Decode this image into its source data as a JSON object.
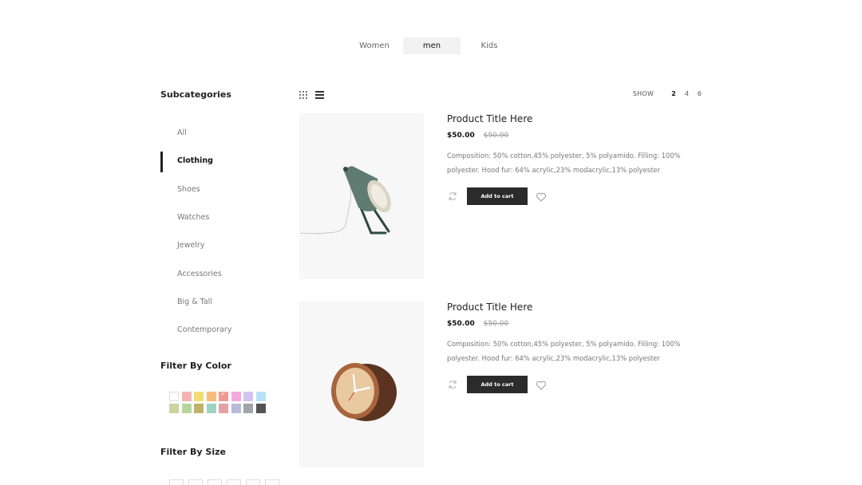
{
  "tabs": [
    {
      "label": "Women",
      "active": false
    },
    {
      "label": "men",
      "active": true
    },
    {
      "label": "Kids",
      "active": false
    }
  ],
  "sidebar": {
    "subcategories_title": "Subcategories",
    "subcategories": [
      "All",
      "Clothing",
      "Shoes",
      "Watches",
      "Jewelry",
      "Accessories",
      "Big & Tall",
      "Contemporary"
    ],
    "active_subcategory": "Clothing",
    "color_title": "Filter By Color",
    "colors": [
      "#ffffff",
      "#f4b3b3",
      "#f4dc74",
      "#f6bd7a",
      "#f2998f",
      "#f5a8de",
      "#d4c2f3",
      "#b8e0f5",
      "#cad2a2",
      "#b6d59e",
      "#c0b267",
      "#9fd4c4",
      "#e0a2a7",
      "#b6bbd9",
      "#a3a3ac",
      "#545454"
    ],
    "selected_color_index": 4,
    "size_title": "Filter By Size"
  },
  "toolbar": {
    "show_label": "SHOW",
    "show_options": [
      "2",
      "4",
      "6"
    ],
    "show_selected": "2"
  },
  "products": [
    {
      "title": "Product Title Here",
      "price": "$50.00",
      "old_price": "$50.00",
      "description": "Composition: 50% cotton,45% polyester, 5% polyamido. Filling: 100% polyester. Hood fur: 64% acrylic,23% modacrylic,13% polyester",
      "cart_label": "Add to cart",
      "image": "desk-lamp"
    },
    {
      "title": "Product Title Here",
      "price": "$50.00",
      "old_price": "$50.00",
      "description": "Composition: 50% cotton,45% polyester, 5% polyamido. Filling: 100% polyester. Hood fur: 64% acrylic,23% modacrylic,13% polyester",
      "cart_label": "Add to cart",
      "image": "wooden-clock"
    }
  ]
}
